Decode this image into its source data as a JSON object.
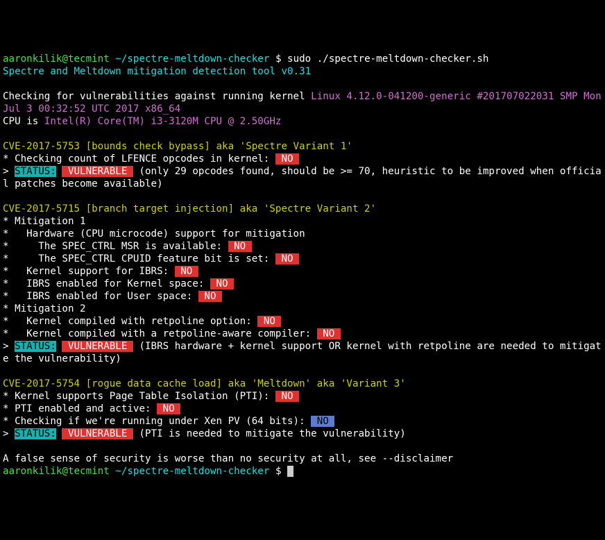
{
  "prompt": {
    "user": "aaronkilik@tecmint",
    "path": "~/spectre-meltdown-checker",
    "sep": "$",
    "cmd": "sudo ./spectre-meltdown-checker.sh"
  },
  "header": "Spectre and Meltdown mitigation detection tool v0.31",
  "check_label": "Checking for vulnerabilities against running kernel ",
  "kernel": "Linux 4.12.0-041200-generic #201707022031 SMP Mon Jul 3 00:32:52 UTC 2017 x86_64",
  "cpu_label": "CPU is ",
  "cpu": "Intel(R) Core(TM) i3-3120M CPU @ 2.50GHz",
  "cve1": {
    "title": "CVE-2017-5753 [bounds check bypass] aka 'Spectre Variant 1'",
    "l1a": "* Checking count of LFENCE opcodes in kernel: ",
    "status_label": "STATUS:",
    "status_val": " VULNERABLE ",
    "note": " (only 29 opcodes found, should be >= 70, heuristic to be improved when official patches become available)"
  },
  "cve2": {
    "title": "CVE-2017-5715 [branch target injection] aka 'Spectre Variant 2'",
    "m1": "* Mitigation 1",
    "l1": "*   Hardware (CPU microcode) support for mitigation",
    "l2": "*     The SPEC_CTRL MSR is available: ",
    "l3": "*     The SPEC_CTRL CPUID feature bit is set: ",
    "l4": "*   Kernel support for IBRS: ",
    "l5": "*   IBRS enabled for Kernel space: ",
    "l6": "*   IBRS enabled for User space: ",
    "m2": "* Mitigation 2",
    "l7": "*   Kernel compiled with retpoline option: ",
    "l8": "*   Kernel compiled with a retpoline-aware compiler: ",
    "status_label": "STATUS:",
    "status_val": " VULNERABLE ",
    "note": " (IBRS hardware + kernel support OR kernel with retpoline are needed to mitigate the vulnerability)"
  },
  "cve3": {
    "title": "CVE-2017-5754 [rogue data cache load] aka 'Meltdown' aka 'Variant 3'",
    "l1": "* Kernel supports Page Table Isolation (PTI): ",
    "l2": "* PTI enabled and active: ",
    "l3": "* Checking if we're running under Xen PV (64 bits): ",
    "status_label": "STATUS:",
    "status_val": " VULNERABLE ",
    "note": " (PTI is needed to mitigate the vulnerability)"
  },
  "no": " NO ",
  "gt": "> ",
  "footer": "A false sense of security is worse than no security at all, see --disclaimer",
  "prompt2": {
    "user": "aaronkilik@tecmint",
    "path": "~/spectre-meltdown-checker",
    "sep": "$"
  }
}
